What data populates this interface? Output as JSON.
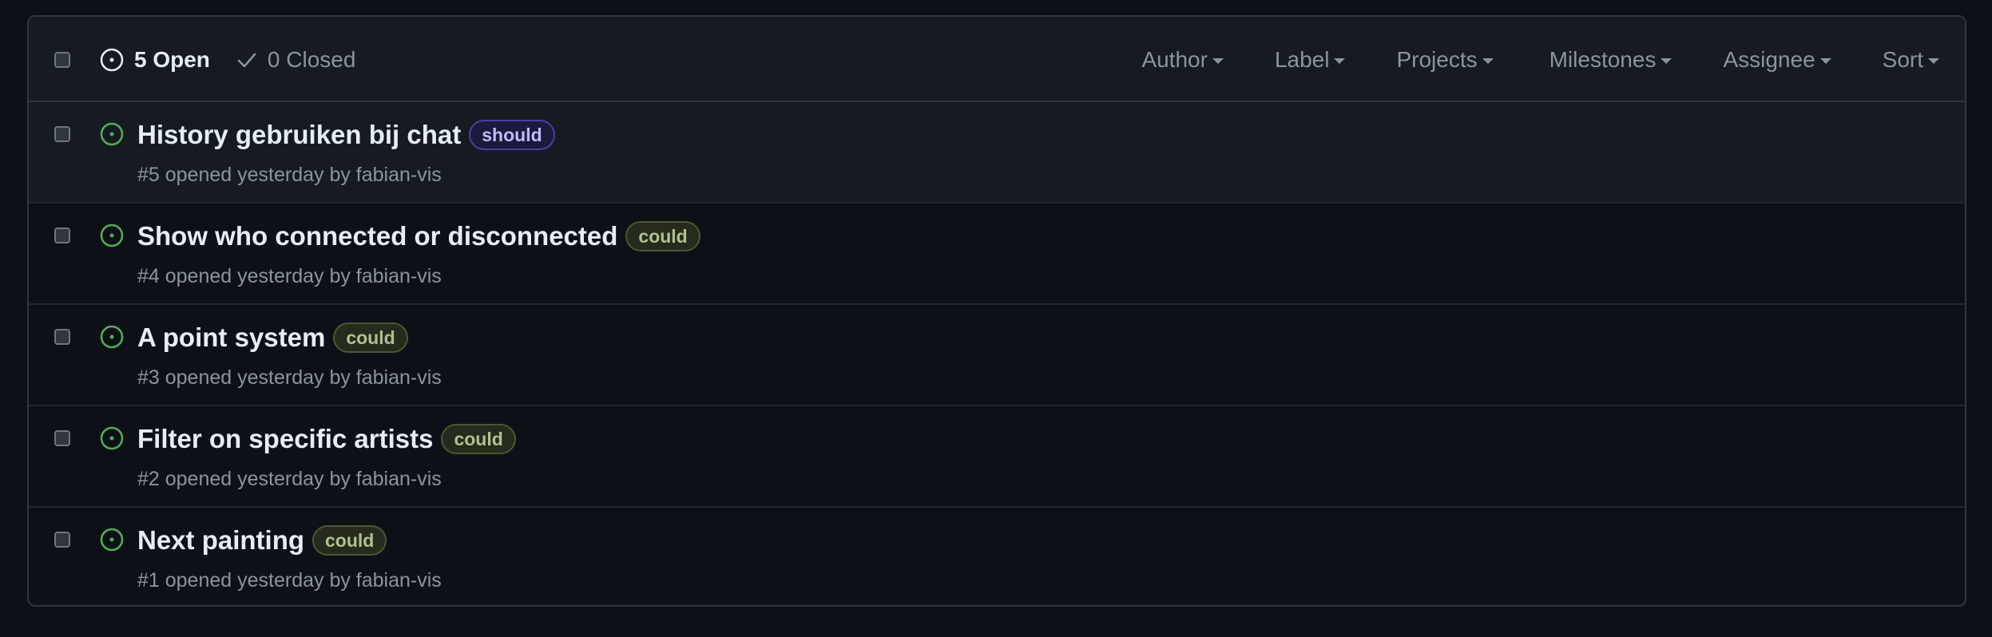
{
  "header": {
    "open_label": "5 Open",
    "closed_label": "0 Closed",
    "filters": [
      "Author",
      "Label",
      "Projects",
      "Milestones",
      "Assignee",
      "Sort"
    ]
  },
  "colors": {
    "open_icon": "#57ab5a",
    "should_bg": "#1c1a3b",
    "should_border": "#4a3fa1",
    "should_text": "#c2b8ff",
    "could_bg": "#262b1d",
    "could_border": "#4c5634",
    "could_text": "#b3bf8f"
  },
  "issues": [
    {
      "title": "History gebruiken bij chat",
      "label": "should",
      "meta": "#5 opened yesterday by fabian-vis"
    },
    {
      "title": "Show who connected or disconnected",
      "label": "could",
      "meta": "#4 opened yesterday by fabian-vis"
    },
    {
      "title": "A point system",
      "label": "could",
      "meta": "#3 opened yesterday by fabian-vis"
    },
    {
      "title": "Filter on specific artists",
      "label": "could",
      "meta": "#2 opened yesterday by fabian-vis"
    },
    {
      "title": "Next painting",
      "label": "could",
      "meta": "#1 opened yesterday by fabian-vis"
    }
  ]
}
